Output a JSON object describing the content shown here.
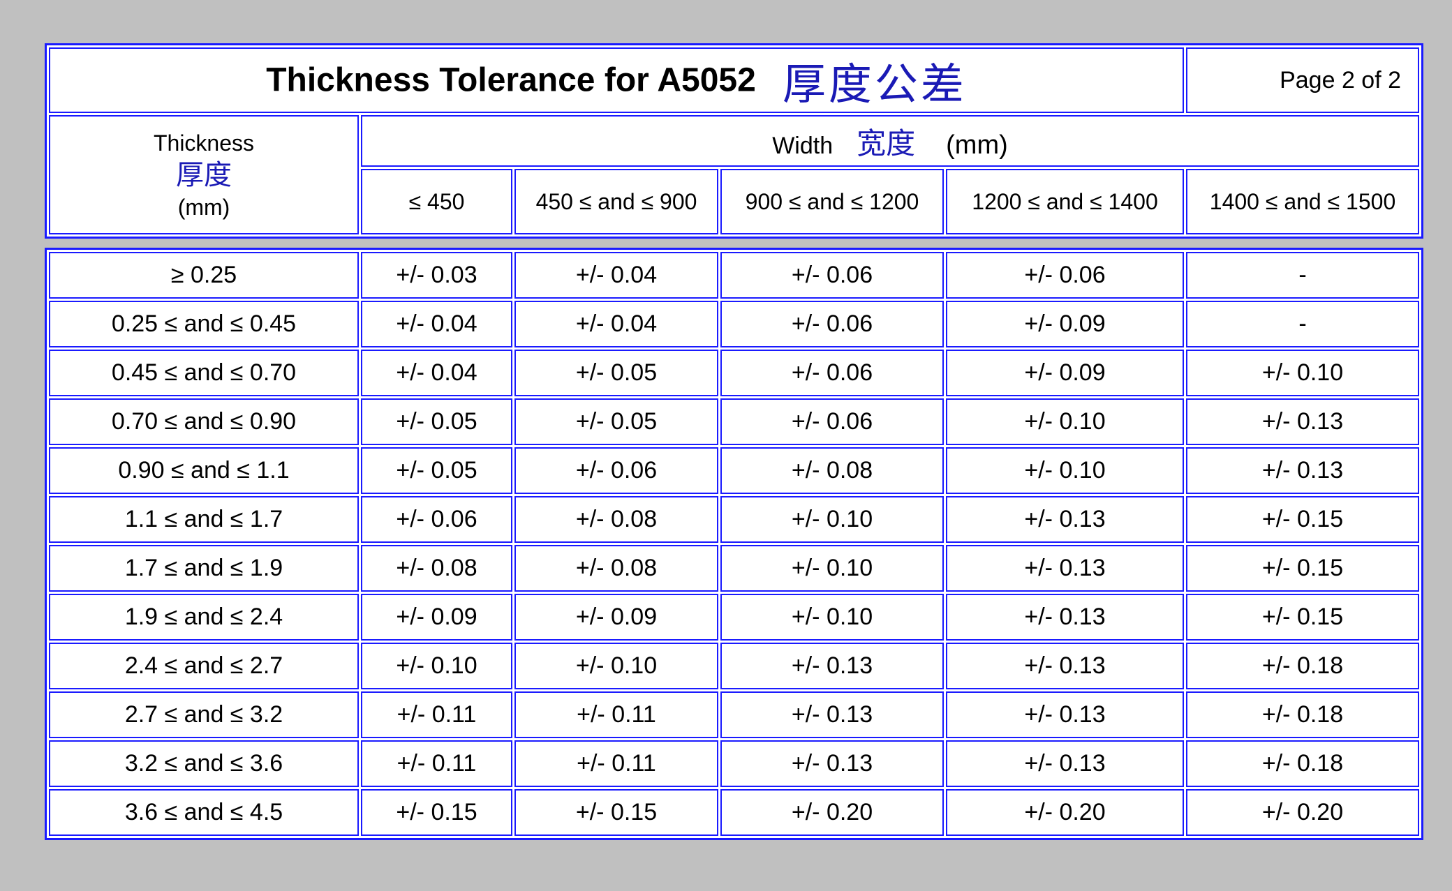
{
  "title": {
    "english": "Thickness Tolerance for A5052",
    "chinese": "厚度公差",
    "page": "Page 2 of 2"
  },
  "thickness_header": {
    "label": "Thickness",
    "chinese": "厚度",
    "unit": "(mm)"
  },
  "width_header": {
    "label": "Width",
    "chinese": "宽度",
    "unit": "(mm)"
  },
  "width_columns": [
    "≤ 450",
    "450 ≤ and ≤ 900",
    "900 ≤ and ≤ 1200",
    "1200 ≤ and ≤ 1400",
    "1400 ≤ and ≤ 1500"
  ],
  "rows": [
    {
      "thickness": "≥ 0.25",
      "values": [
        "+/- 0.03",
        "+/- 0.04",
        "+/- 0.06",
        "+/- 0.06",
        "-"
      ]
    },
    {
      "thickness": "0.25 ≤ and ≤ 0.45",
      "values": [
        "+/- 0.04",
        "+/- 0.04",
        "+/- 0.06",
        "+/- 0.09",
        "-"
      ]
    },
    {
      "thickness": "0.45 ≤ and ≤ 0.70",
      "values": [
        "+/- 0.04",
        "+/- 0.05",
        "+/- 0.06",
        "+/- 0.09",
        "+/- 0.10"
      ]
    },
    {
      "thickness": "0.70 ≤ and ≤ 0.90",
      "values": [
        "+/- 0.05",
        "+/- 0.05",
        "+/- 0.06",
        "+/- 0.10",
        "+/- 0.13"
      ]
    },
    {
      "thickness": "0.90 ≤ and ≤ 1.1",
      "values": [
        "+/- 0.05",
        "+/- 0.06",
        "+/- 0.08",
        "+/- 0.10",
        "+/- 0.13"
      ]
    },
    {
      "thickness": "1.1 ≤ and ≤ 1.7",
      "values": [
        "+/- 0.06",
        "+/- 0.08",
        "+/- 0.10",
        "+/- 0.13",
        "+/- 0.15"
      ]
    },
    {
      "thickness": "1.7 ≤ and ≤ 1.9",
      "values": [
        "+/- 0.08",
        "+/- 0.08",
        "+/- 0.10",
        "+/- 0.13",
        "+/- 0.15"
      ]
    },
    {
      "thickness": "1.9 ≤ and ≤ 2.4",
      "values": [
        "+/- 0.09",
        "+/- 0.09",
        "+/- 0.10",
        "+/- 0.13",
        "+/- 0.15"
      ]
    },
    {
      "thickness": "2.4 ≤ and ≤ 2.7",
      "values": [
        "+/- 0.10",
        "+/- 0.10",
        "+/- 0.13",
        "+/- 0.13",
        "+/- 0.18"
      ]
    },
    {
      "thickness": "2.7 ≤ and ≤ 3.2",
      "values": [
        "+/- 0.11",
        "+/- 0.11",
        "+/- 0.13",
        "+/- 0.13",
        "+/- 0.18"
      ]
    },
    {
      "thickness": "3.2 ≤ and ≤ 3.6",
      "values": [
        "+/- 0.11",
        "+/- 0.11",
        "+/- 0.13",
        "+/- 0.13",
        "+/- 0.18"
      ]
    },
    {
      "thickness": "3.6 ≤ and ≤ 4.5",
      "values": [
        "+/- 0.15",
        "+/- 0.15",
        "+/- 0.20",
        "+/- 0.20",
        "+/- 0.20"
      ]
    }
  ],
  "colors": {
    "border": "#1a1aff",
    "chinese_text": "#1a1ab5",
    "background": "#c0c0c0"
  }
}
